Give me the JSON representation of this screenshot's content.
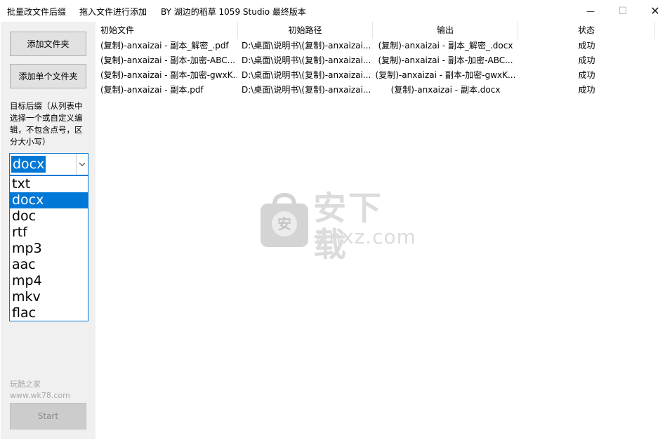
{
  "window": {
    "title_parts": [
      "批量改文件后缀",
      "拖入文件进行添加",
      "BY 湖边的稻草 1059 Studio 最终版本"
    ],
    "minimize_glyph": "—",
    "maximize_glyph": "☐",
    "close_glyph": "✕"
  },
  "sidebar": {
    "add_folder_label": "添加文件夹",
    "add_single_label": "添加单个文件夹",
    "suffix_hint": "目标后缀（从列表中选择一个或自定义编辑，不包含点号，区分大小写）",
    "combo_value": "docx",
    "options": [
      "txt",
      "docx",
      "doc",
      "rtf",
      "mp3",
      "aac",
      "mp4",
      "mkv",
      "flac"
    ],
    "selected_index": 1,
    "watermark_line1": "玩酷之家",
    "watermark_line2": "www.wk78.com",
    "start_label": "Start"
  },
  "table": {
    "columns": [
      "初始文件",
      "初始路径",
      "输出",
      "状态"
    ],
    "rows": [
      {
        "file": "(复制)-anxaizai - 副本_解密_.pdf",
        "path": "D:\\桌面\\说明书\\(复制)-anxaizai...",
        "output": "(复制)-anxaizai - 副本_解密_.docx",
        "status": "成功"
      },
      {
        "file": "(复制)-anxaizai - 副本-加密-ABC...",
        "path": "D:\\桌面\\说明书\\(复制)-anxaizai...",
        "output": "(复制)-anxaizai - 副本-加密-ABC...",
        "status": "成功"
      },
      {
        "file": "(复制)-anxaizai - 副本-加密-gwxK...",
        "path": "D:\\桌面\\说明书\\(复制)-anxaizai...",
        "output": "(复制)-anxaizai - 副本-加密-gwxK...",
        "status": "成功"
      },
      {
        "file": "(复制)-anxaizai - 副本.pdf",
        "path": "D:\\桌面\\说明书\\(复制)-anxaizai...",
        "output": "(复制)-anxaizai - 副本.docx",
        "status": "成功"
      }
    ]
  },
  "watermark": {
    "logo_glyph": "安",
    "title": "安下载",
    "subtitle": "anxz.com"
  }
}
